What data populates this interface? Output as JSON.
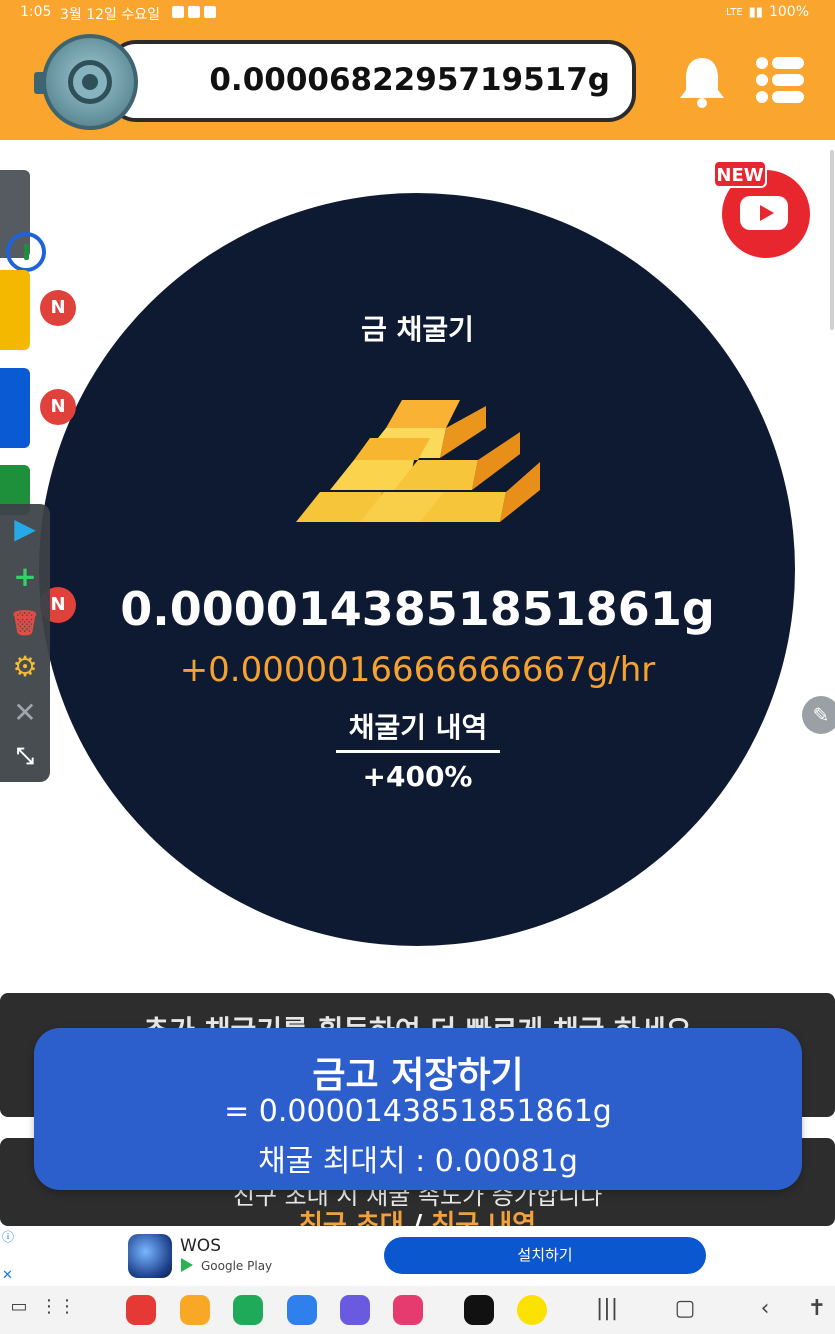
{
  "status_bar": {
    "time": "1:05",
    "date": "3월 12일 수요일",
    "network": "LTE",
    "battery": "100%"
  },
  "header": {
    "balance": "0.0000682295719517g",
    "vault_icon": "vault-icon",
    "bell_icon": "bell-icon",
    "menu_icon": "menu-icon",
    "accent_color": "#f9a52e"
  },
  "side_tools": {
    "badges": [
      "N",
      "N",
      "N"
    ],
    "tools": [
      "play-icon",
      "plus-icon",
      "trash-icon",
      "gear-icon",
      "close-icon",
      "collapse-icon"
    ]
  },
  "miner": {
    "title": "금 채굴기",
    "amount": "0.0000143851851861g",
    "rate": "+0.0000016666666667g/hr",
    "history_link": "채굴기 내역",
    "boost": "+400%",
    "circle_color": "#0e1a31",
    "rate_color": "#f6a230"
  },
  "youtube": {
    "badge": "NEW",
    "icon": "youtube-icon"
  },
  "banner_top": {
    "text": "추가 채굴기를 획득하여 더 빠르게 채굴 하세요"
  },
  "banner_bottom": {
    "text": "친구 초대 시 채굴 속도가 증가합니다",
    "link_invite": "친구 초대",
    "separator": "/",
    "link_history": "친구 내역"
  },
  "save_popup": {
    "title": "금고 저장하기",
    "amount_line": "= 0.0000143851851861g",
    "max_line": "채굴 최대치 : 0.00081g",
    "color": "#2d5fcc"
  },
  "ad": {
    "info_icon": "ⓘ",
    "close_icon": "✕",
    "app_name": "WOS",
    "store": "Google Play",
    "cta": "설치하기"
  },
  "navbar": {
    "apps": [
      "flipboard",
      "files",
      "phone",
      "messages",
      "internet",
      "camera",
      "tiktok",
      "kakaotalk"
    ]
  }
}
